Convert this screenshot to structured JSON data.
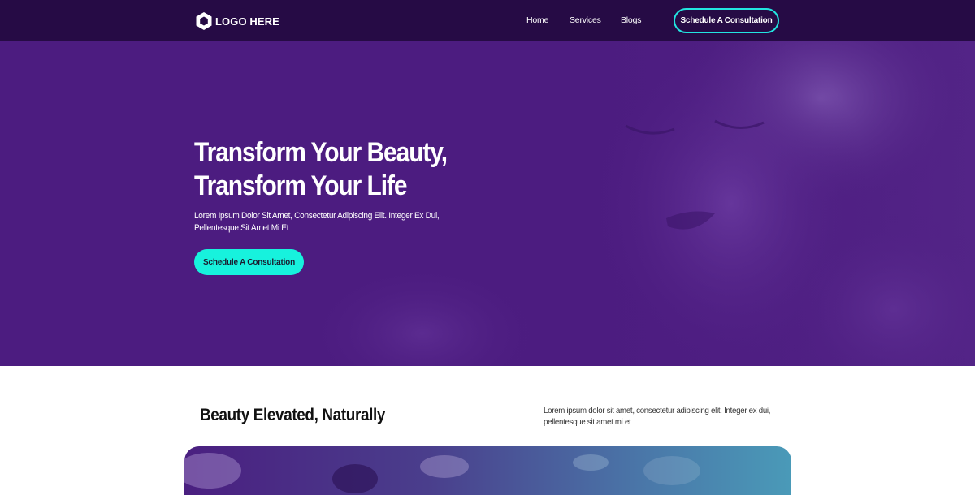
{
  "nav": {
    "logo_text": "LOGO HERE",
    "links": [
      "Home",
      "Services",
      "Blogs"
    ],
    "cta_label": "Schedule A Consultation"
  },
  "hero": {
    "title_line1": "Transform Your Beauty,",
    "title_line2": "Transform Your Life",
    "subtitle_line1": "Lorem Ipsum Dolor Sit Amet, Consectetur Adipiscing Elit. Integer Ex Dui,",
    "subtitle_line2": "Pellentesque Sit Amet Mi Et",
    "cta_label": "Schedule A Consultation"
  },
  "section2": {
    "title": "Beauty Elevated, Naturally",
    "text_line1": "Lorem ipsum dolor sit amet, consectetur adipiscing elit. Integer ex dui,",
    "text_line2": "pellentesque sit amet mi et"
  },
  "colors": {
    "nav_bg": "#260b45",
    "hero_bg": "#4c1c80",
    "accent": "#17f2dd",
    "outline_accent": "#22e5e0"
  }
}
